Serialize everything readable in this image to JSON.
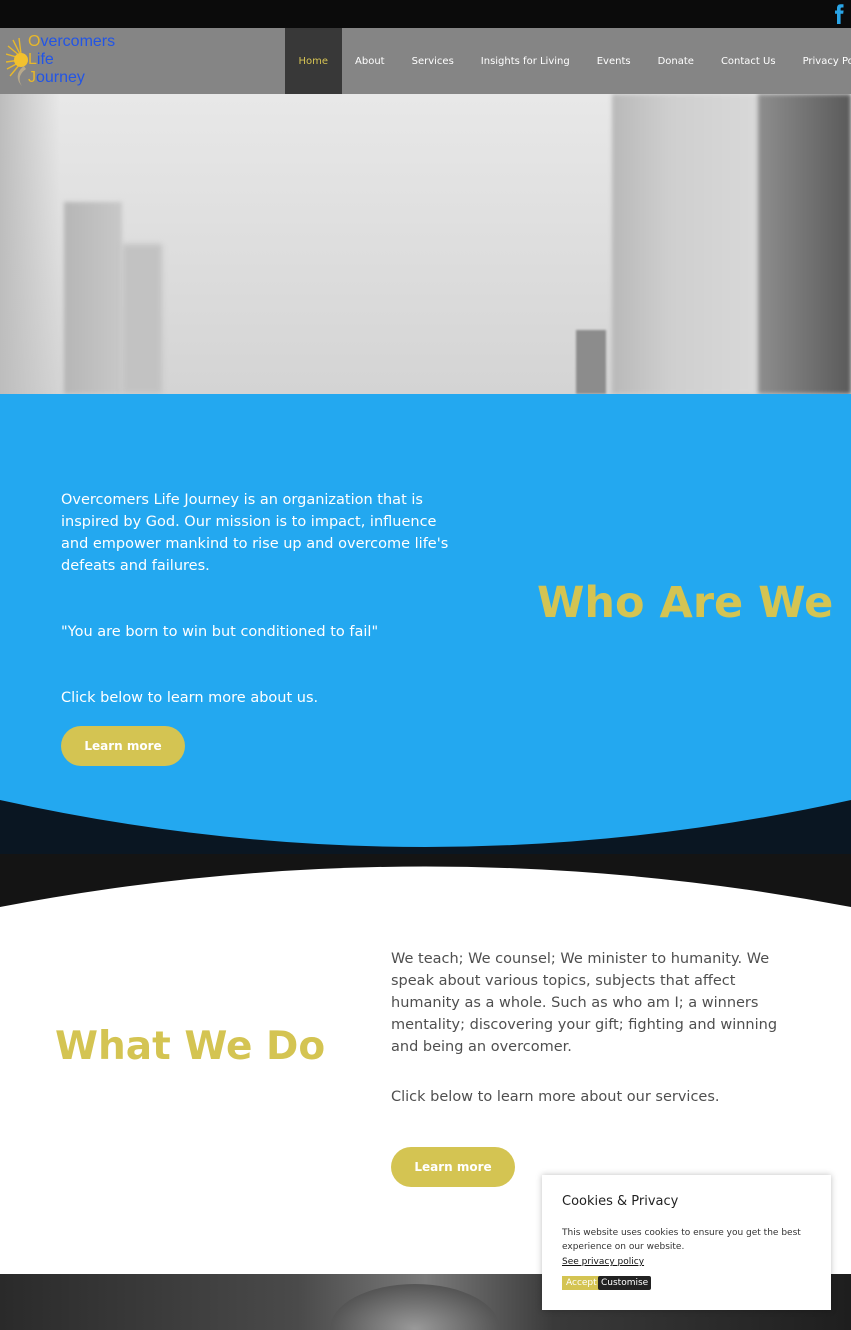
{
  "topbar": {
    "social_icon": "facebook-icon"
  },
  "logo": {
    "line1_first": "O",
    "line1_rest": "vercomers",
    "line2_first": "L",
    "line2_rest": "ife",
    "line3_first": "J",
    "line3_rest": "ourney"
  },
  "nav": {
    "items": [
      "Home",
      "About",
      "Services",
      "Insights for Living",
      "Events",
      "Donate",
      "Contact Us",
      "Privacy Policy"
    ],
    "active": "Home"
  },
  "who": {
    "paragraph1": "Overcomers Life Journey is an organization that is inspired by God. Our mission is to impact, influence and empower mankind to rise up and overcome life's defeats and failures.",
    "quote": "\"You are born to win but conditioned to fail\"",
    "cta_text": "Click below to learn more about us.",
    "button": "Learn more",
    "title": "Who Are We"
  },
  "what": {
    "title": "What We Do",
    "paragraph1": "We teach; We counsel; We minister to humanity. We speak about various topics, subjects that affect humanity as a whole. Such as who am I; a winners mentality; discovering your gift; fighting and winning and being an overcomer.",
    "cta_text": "Click below to learn more about our services.",
    "button": "Learn more"
  },
  "cookie": {
    "title": "Cookies & Privacy",
    "body": "This website uses cookies to ensure you get the best experience on our website.",
    "link": "See privacy policy",
    "accept": "Accept",
    "customise": "Customise"
  },
  "colors": {
    "accent": "#d4c452",
    "blue": "#23a8f0",
    "header": "#858585",
    "dark": "#0b0b0b"
  }
}
